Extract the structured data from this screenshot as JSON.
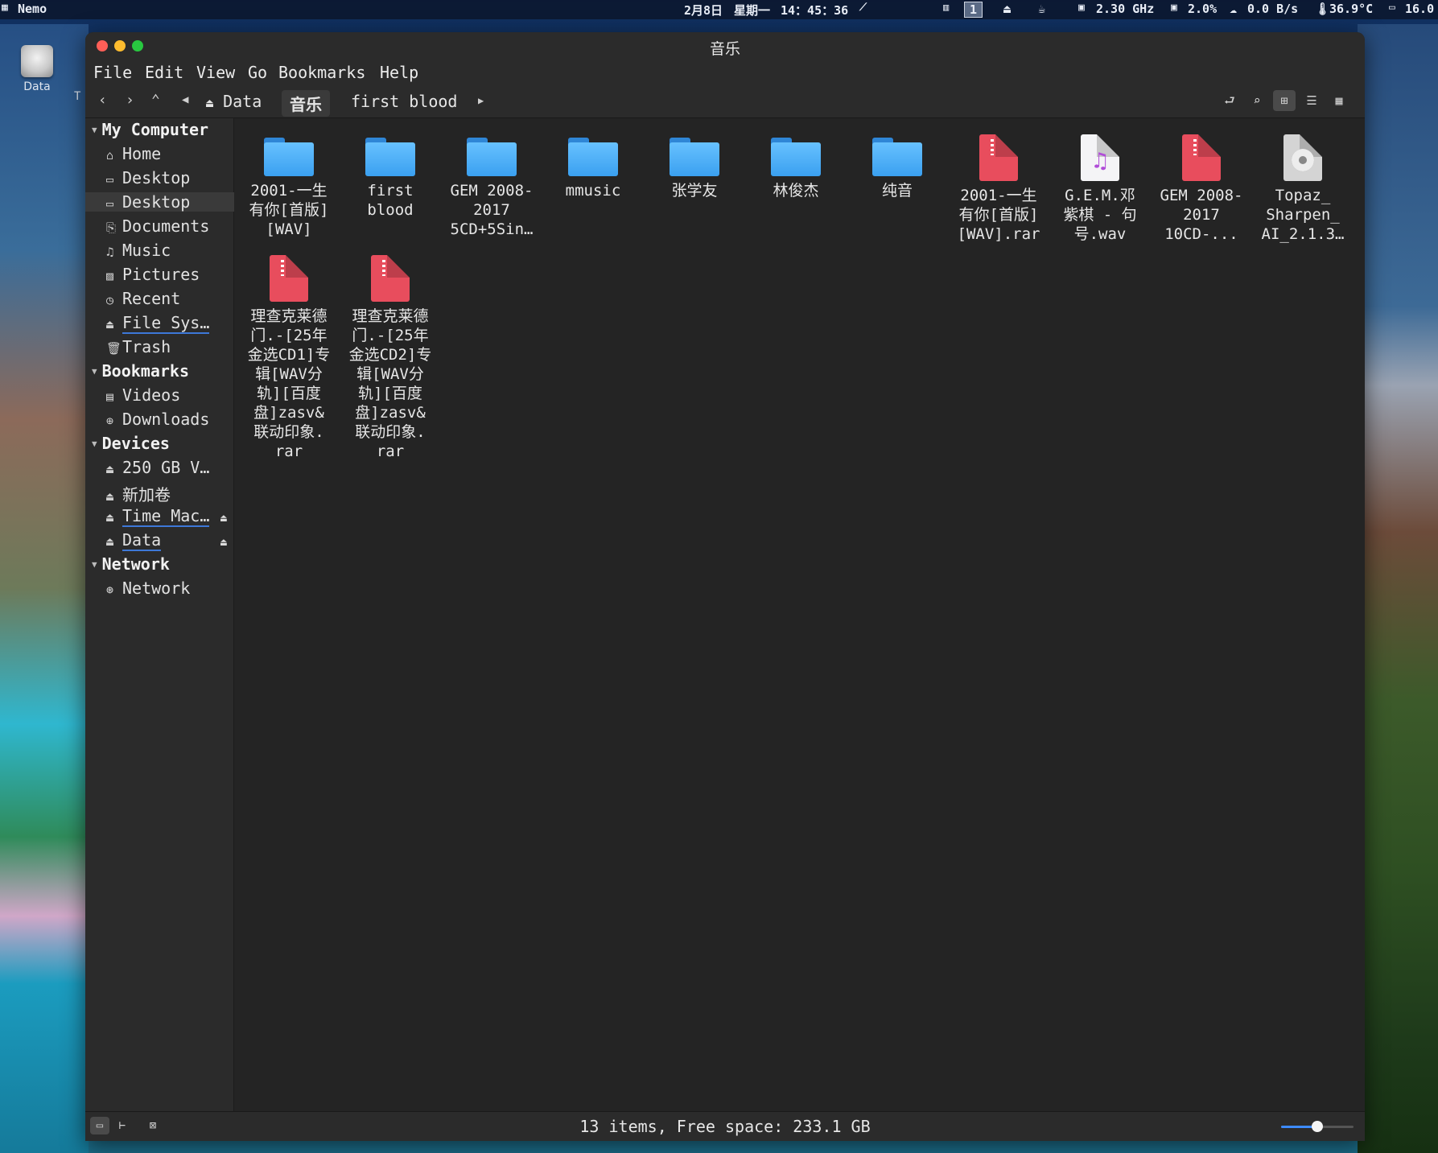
{
  "topbar": {
    "app_name": "Nemo",
    "date": "2月8日",
    "weekday": "星期一",
    "time": "14：45：36",
    "workspace": "1",
    "cpu_freq": "2.30 GHz",
    "cpu_usage": "2.0%",
    "net_speed": "0.0 B/s",
    "temperature": "36.9°C",
    "battery": "16.0"
  },
  "desktop": {
    "drive_label": "Data",
    "partial_label": "T"
  },
  "window": {
    "title": "音乐",
    "colors": {
      "close": "#ff5f57",
      "minimize": "#febc2e",
      "maximize": "#28c840",
      "accent": "#3d78d8"
    }
  },
  "menu": [
    "File",
    "Edit",
    "View",
    "Go",
    "Bookmarks",
    "Help"
  ],
  "breadcrumbs": [
    {
      "label": "Data",
      "icon": "drive-icon"
    },
    {
      "label": "音乐",
      "active": true
    },
    {
      "label": "first blood"
    }
  ],
  "sidebar": {
    "sections": [
      {
        "title": "My Computer",
        "items": [
          "Home",
          "Desktop",
          "Desktop",
          "Documents",
          "Music",
          "Pictures",
          "Recent",
          "File Sys…",
          "Trash"
        ]
      },
      {
        "title": "Bookmarks",
        "items": [
          "Videos",
          "Downloads"
        ]
      },
      {
        "title": "Devices",
        "items": [
          "250 GB V…",
          "新加卷",
          "Time Mac…",
          "Data"
        ]
      },
      {
        "title": "Network",
        "items": [
          "Network"
        ]
      }
    ]
  },
  "files": [
    {
      "name": "2001-一生有你[首版][WAV]",
      "lines": [
        "2001-一生",
        "有你[首版]",
        "[WAV]"
      ],
      "type": "folder"
    },
    {
      "name": "first blood",
      "lines": [
        "first",
        "blood"
      ],
      "type": "folder"
    },
    {
      "name": "GEM 2008-2017 5CD+5Sin…",
      "lines": [
        "GEM 2008-",
        "2017",
        "5CD+5Sin…"
      ],
      "type": "folder"
    },
    {
      "name": "mmusic",
      "lines": [
        "mmusic"
      ],
      "type": "folder"
    },
    {
      "name": "张学友",
      "lines": [
        "张学友"
      ],
      "type": "folder"
    },
    {
      "name": "林俊杰",
      "lines": [
        "林俊杰"
      ],
      "type": "folder"
    },
    {
      "name": "纯音",
      "lines": [
        "纯音"
      ],
      "type": "folder"
    },
    {
      "name": "2001-一生有你[首版][WAV].rar",
      "lines": [
        "2001-一生",
        "有你[首版]",
        "[WAV].rar"
      ],
      "type": "archive"
    },
    {
      "name": "G.E.M.邓紫棋 - 句号.wav",
      "lines": [
        "G.E.M.邓",
        "紫棋 - 句",
        "号.wav"
      ],
      "type": "audio"
    },
    {
      "name": "GEM 2008-2017 10CD-…",
      "lines": [
        "GEM 2008-",
        "2017",
        "10CD-..."
      ],
      "type": "archive"
    },
    {
      "name": "Topaz_Sharpen_AI_2.1.3…",
      "lines": [
        "Topaz_",
        "Sharpen_",
        "AI_2.1.3…"
      ],
      "type": "disc-image"
    },
    {
      "name": "理查克莱德门.-[25年金选CD1]专辑[WAV分轨][百度盘]zasv&联动印象.rar",
      "lines": [
        "理查克莱德",
        "门.-[25年",
        "金选CD1]专",
        "辑[WAV分",
        "轨][百度",
        "盘]zasv&",
        "联动印象.",
        "rar"
      ],
      "type": "archive"
    },
    {
      "name": "理查克莱德门.-[25年金选CD2]专辑[WAV分轨][百度盘]zasv&联动印象.rar",
      "lines": [
        "理查克莱德",
        "门.-[25年",
        "金选CD2]专",
        "辑[WAV分",
        "轨][百度",
        "盘]zasv&",
        "联动印象.",
        "rar"
      ],
      "type": "archive"
    }
  ],
  "status": {
    "text": "13 items, Free space: 233.1 GB",
    "zoom_level": 0.5
  }
}
